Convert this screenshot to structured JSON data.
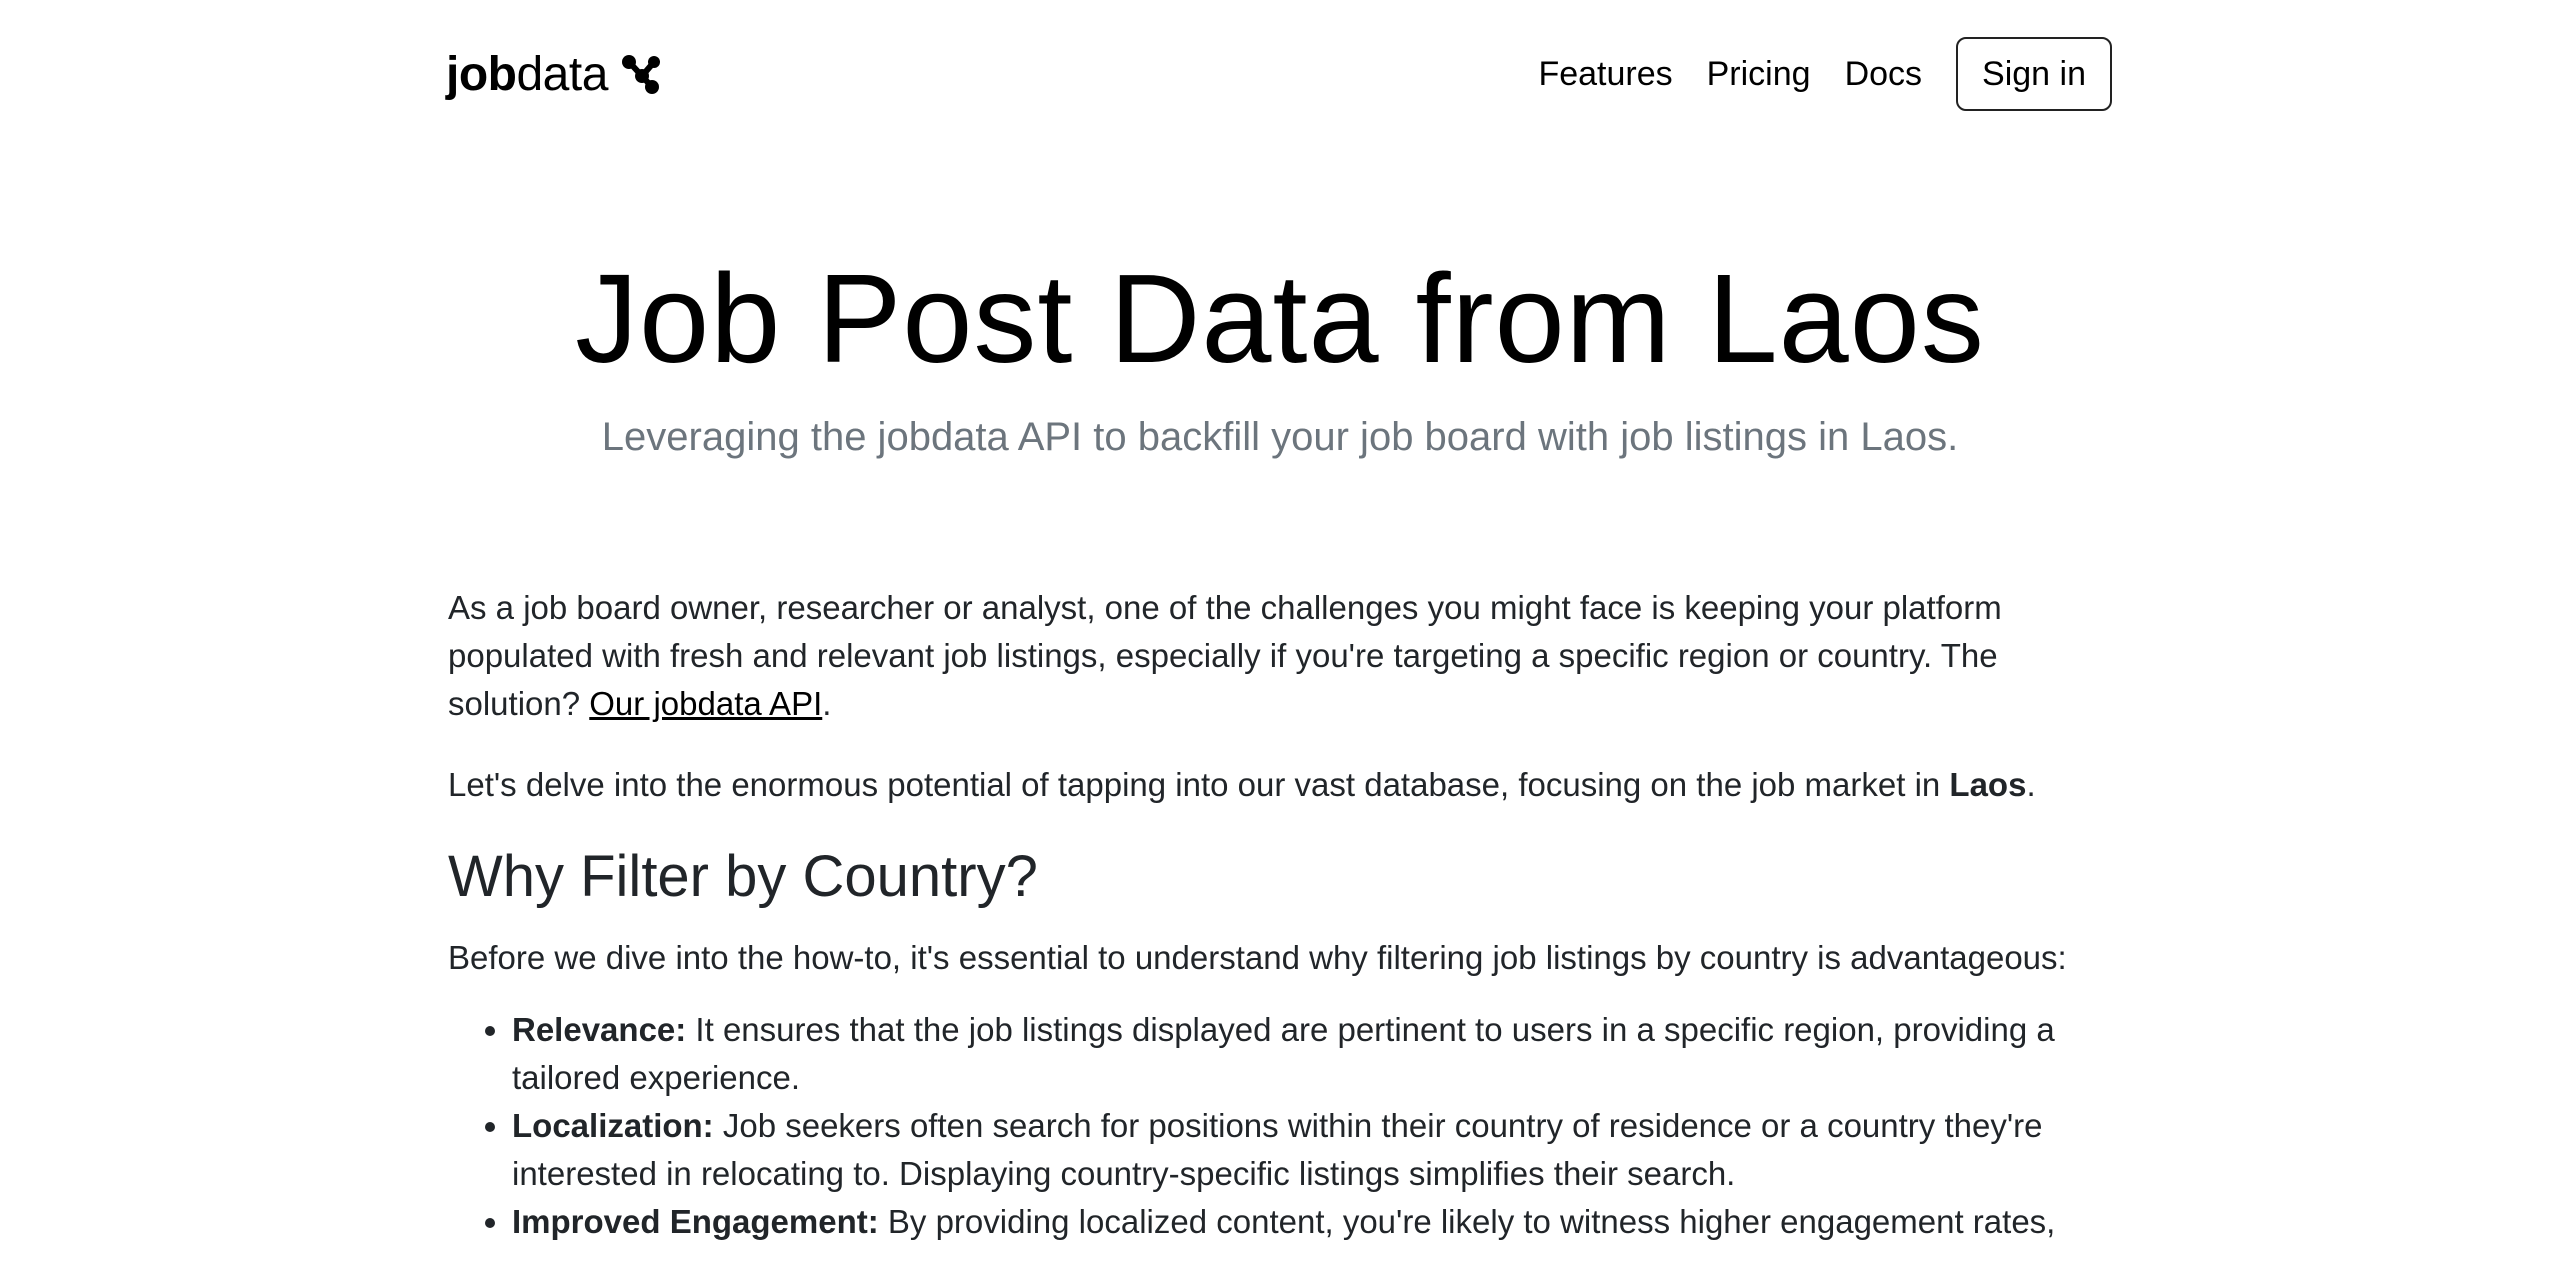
{
  "header": {
    "brand_bold": "job",
    "brand_light": "data",
    "brand_icon": "molecule-logo-icon",
    "nav": {
      "features": "Features",
      "pricing": "Pricing",
      "docs": "Docs",
      "signin": "Sign in"
    }
  },
  "hero": {
    "title": "Job Post Data from Laos",
    "subtitle": "Leveraging the jobdata API to backfill your job board with job listings in Laos."
  },
  "content": {
    "intro_text": "As a job board owner, researcher or analyst, one of the challenges you might face is keeping your platform populated with fresh and relevant job listings, especially if you're targeting a specific region or country. The solution? ",
    "intro_link": "Our jobdata API",
    "intro_end": ".",
    "delve_text": "Let's delve into the enormous potential of tapping into our vast database, focusing on the job market in ",
    "delve_country": "Laos",
    "delve_end": ".",
    "section_heading": "Why Filter by Country?",
    "section_intro": "Before we dive into the how-to, it's essential to understand why filtering job listings by country is advantageous:",
    "bullets": [
      {
        "term": "Relevance:",
        "text": " It ensures that the job listings displayed are pertinent to users in a specific region, providing a tailored experience."
      },
      {
        "term": "Localization:",
        "text": " Job seekers often search for positions within their country of residence or a country they're interested in relocating to. Displaying country-specific listings simplifies their search."
      },
      {
        "term": "Improved Engagement:",
        "text": " By providing localized content, you're likely to witness higher engagement rates,"
      }
    ]
  }
}
